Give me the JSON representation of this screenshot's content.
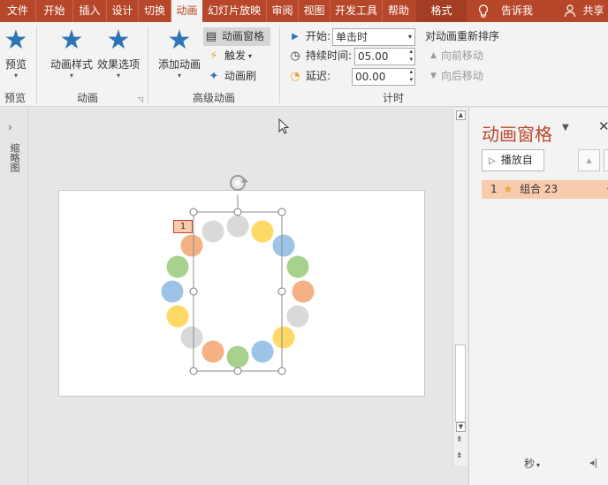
{
  "tabs": [
    "文件",
    "开始",
    "插入",
    "设计",
    "切换",
    "动画",
    "幻灯片放映",
    "审阅",
    "视图",
    "开发工具",
    "帮助",
    "格式"
  ],
  "tell_me": "告诉我",
  "share": "共享",
  "ribbon": {
    "preview": "预览",
    "preview_group": "预览",
    "anim_styles": "动画样式",
    "effect_options": "效果选项",
    "anim_group": "动画",
    "add_anim": "添加动画",
    "anim_pane": "动画窗格",
    "trigger": "触发",
    "anim_painter": "动画刷",
    "adv_group": "高级动画",
    "start_label": "开始:",
    "start_value": "单击时",
    "duration_label": "持续时间:",
    "duration_value": "05.00",
    "delay_label": "延迟:",
    "delay_value": "00.00",
    "timing_group": "计时",
    "reorder": "对动画重新排序",
    "move_earlier": "向前移动",
    "move_later": "向后移动"
  },
  "left_strip": {
    "label": "缩略图"
  },
  "slide": {
    "anim_badge": "1"
  },
  "pane": {
    "title": "动画窗格",
    "play_from": "播放自",
    "items": [
      {
        "num": "1",
        "label": "组合 23"
      }
    ],
    "seconds": "秒"
  },
  "colors": {
    "accent": "#b7472a",
    "gray": "#d9d9d9",
    "yellow": "#ffd966",
    "blue": "#9dc3e6",
    "green": "#a9d18e",
    "orange": "#f4b183"
  }
}
